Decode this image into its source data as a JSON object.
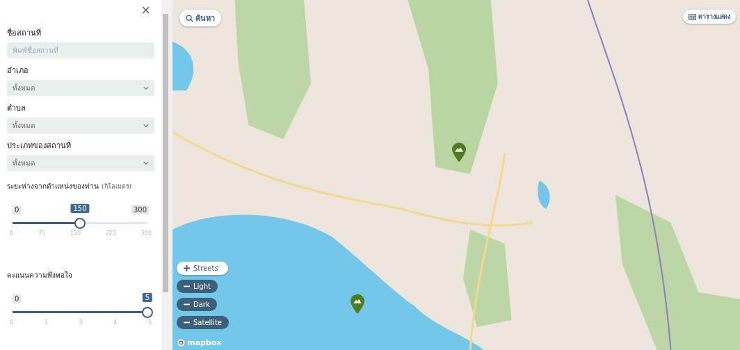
{
  "panel": {
    "close": "×",
    "name_field": {
      "label": "ชื่อสถานที่",
      "placeholder": "พิมพ์ชื่อสถานที่"
    },
    "selects": [
      {
        "label": "อำเภอ",
        "value": "ทั้งหมด"
      },
      {
        "label": "ตำบล",
        "value": "ทั้งหมด"
      },
      {
        "label": "ประเภทของสถานที่",
        "value": "ทั้งหมด"
      }
    ],
    "sliders": [
      {
        "label": "ระยะห่างจากตำแหน่งของท่าน",
        "unit": "(กิโลเมตร)",
        "min": "0",
        "max": "300",
        "value": "150",
        "level": 0.5,
        "ticks": [
          "0",
          "75",
          "150",
          "225",
          "300"
        ]
      },
      {
        "label": "คะแนนความพึงพอใจ",
        "min": "0",
        "value": "5",
        "level": 1,
        "ticks": [
          "0",
          "1",
          "3",
          "4",
          "5"
        ]
      }
    ]
  },
  "map": {
    "search": "ค้นหา",
    "table": "ตารางแสดง",
    "layers": [
      {
        "label": "Streets",
        "selected": true
      },
      {
        "label": "Light",
        "selected": false
      },
      {
        "label": "Dark",
        "selected": false
      },
      {
        "label": "Satellite",
        "selected": false
      }
    ],
    "attribution": "mapbox"
  }
}
